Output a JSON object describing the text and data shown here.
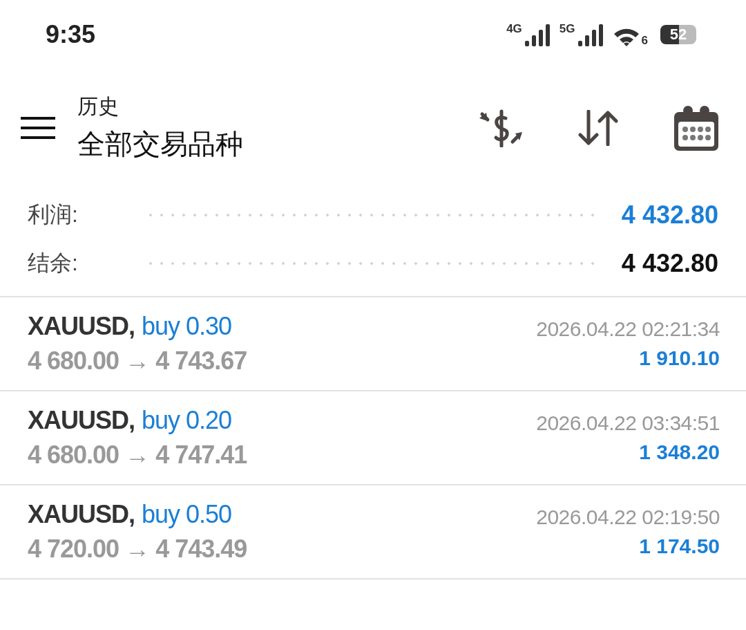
{
  "status_bar": {
    "time": "9:35",
    "network_1": "4G",
    "network_2": "5G",
    "wifi_badge": "6",
    "battery": "52"
  },
  "header": {
    "title": "历史",
    "subtitle": "全部交易品种"
  },
  "summary": [
    {
      "label": "利润:",
      "value": "4 432.80",
      "kind": "highlight"
    },
    {
      "label": "结余:",
      "value": "4 432.80",
      "kind": "plain"
    }
  ],
  "trades": [
    {
      "symbol": "XAUUSD,",
      "side": "buy 0.30",
      "prices": "4 680.00 → 4 743.67",
      "time": "2026.04.22 02:21:34",
      "profit": "1 910.10"
    },
    {
      "symbol": "XAUUSD,",
      "side": "buy 0.20",
      "prices": "4 680.00 → 4 747.41",
      "time": "2026.04.22 03:34:51",
      "profit": "1 348.20"
    },
    {
      "symbol": "XAUUSD,",
      "side": "buy 0.50",
      "prices": "4 720.00 → 4 743.49",
      "time": "2026.04.22 02:19:50",
      "profit": "1 174.50"
    }
  ]
}
